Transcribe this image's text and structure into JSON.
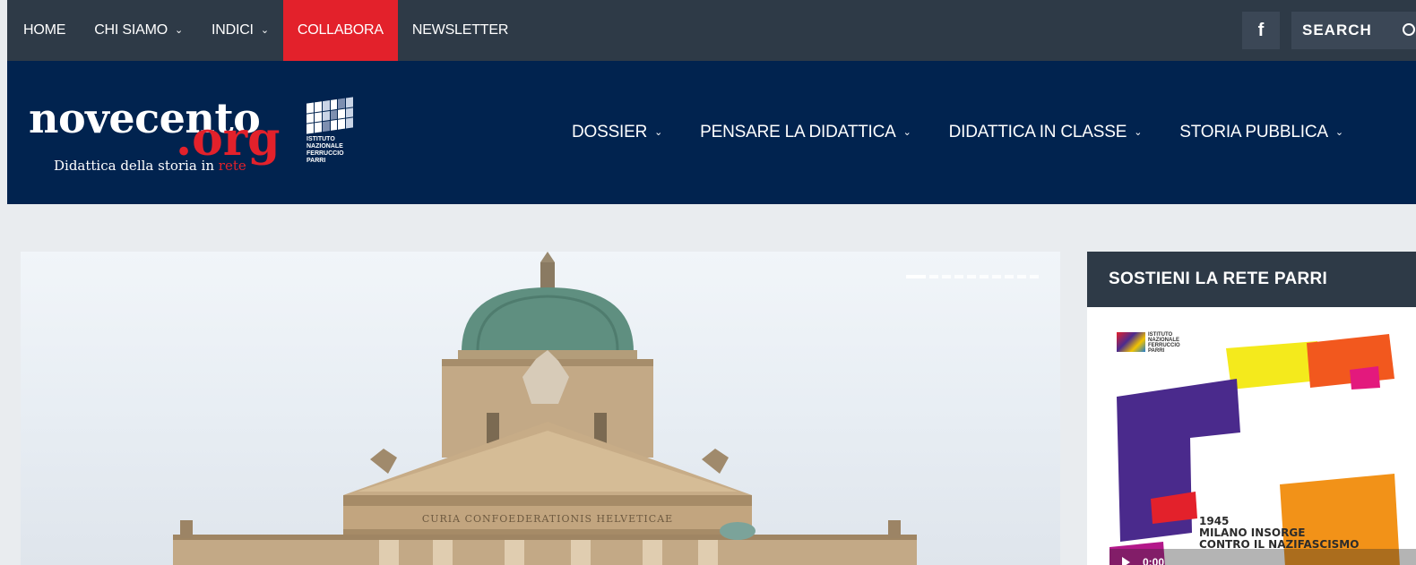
{
  "topbar": {
    "items": [
      {
        "label": "HOME"
      },
      {
        "label": "CHI SIAMO",
        "chevron": "chevron-down-icon"
      },
      {
        "label": "INDICI",
        "chevron": "chevron-down-icon"
      },
      {
        "label": "COLLABORA",
        "active": true
      },
      {
        "label": "NEWSLETTER"
      }
    ],
    "facebook_icon": "facebook-icon",
    "facebook_glyph": "f",
    "search_label": "SEARCH",
    "search_icon": "search-icon"
  },
  "header": {
    "logo": {
      "word": "novecento",
      "domain": ".org",
      "tagline_prefix": "Didattica della storia in ",
      "tagline_suffix": "rete",
      "institute": [
        "ISTITUTO",
        "NAZIONALE",
        "FERRUCCIO",
        "PARRI"
      ]
    },
    "nav": [
      {
        "label": "DOSSIER"
      },
      {
        "label": "PENSARE LA DIDATTICA"
      },
      {
        "label": "DIDATTICA IN CLASSE"
      },
      {
        "label": "STORIA PUBBLICA"
      }
    ]
  },
  "hero": {
    "inscription": "CURIA CONFOEDERATIONIS HELVETICAE",
    "slide_count": 10,
    "active_slide": 1
  },
  "sidebar": {
    "widget_title": "SOSTIENI LA RETE PARRI",
    "poster": {
      "logo_lines": [
        "ISTITUTO",
        "NAZIONALE",
        "FERRUCCIO",
        "PARRI"
      ],
      "lines": [
        "1945",
        "MILANO INSORGE",
        "CONTRO IL NAZIFASCISMO"
      ],
      "video_time": "0:00"
    }
  },
  "colors": {
    "topbar": "#2e3a47",
    "header": "#01234f",
    "accent": "#e3212b",
    "page_bg": "#e9ecef"
  }
}
